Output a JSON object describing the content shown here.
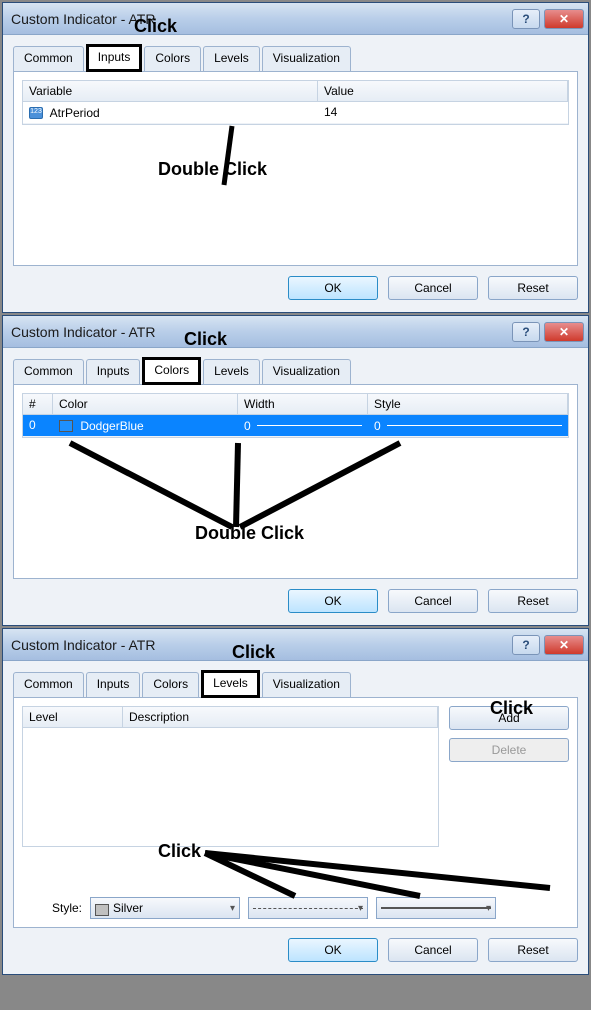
{
  "dialog1": {
    "title": "Custom Indicator - ATR",
    "tabs": [
      "Common",
      "Inputs",
      "Colors",
      "Levels",
      "Visualization"
    ],
    "activeTab": "Inputs",
    "annotations": {
      "clickLabel": "Click",
      "doubleClickLabel": "Double Click"
    },
    "table": {
      "headers": [
        "Variable",
        "Value"
      ],
      "rows": [
        {
          "variable": "AtrPeriod",
          "value": "14"
        }
      ]
    },
    "buttons": {
      "ok": "OK",
      "cancel": "Cancel",
      "reset": "Reset"
    }
  },
  "dialog2": {
    "title": "Custom Indicator - ATR",
    "tabs": [
      "Common",
      "Inputs",
      "Colors",
      "Levels",
      "Visualization"
    ],
    "activeTab": "Colors",
    "annotations": {
      "clickLabel": "Click",
      "doubleClickLabel": "Double Click"
    },
    "table": {
      "headers": [
        "#",
        "Color",
        "Width",
        "Style"
      ],
      "rows": [
        {
          "idx": "0",
          "color": "DodgerBlue",
          "colorHex": "#1E90FF",
          "width": "0",
          "style": "0"
        }
      ]
    },
    "buttons": {
      "ok": "OK",
      "cancel": "Cancel",
      "reset": "Reset"
    }
  },
  "dialog3": {
    "title": "Custom Indicator - ATR",
    "tabs": [
      "Common",
      "Inputs",
      "Colors",
      "Levels",
      "Visualization"
    ],
    "activeTab": "Levels",
    "annotations": {
      "clickLabel": "Click",
      "clickLabel2": "Click",
      "clickLabel3": "Click"
    },
    "table": {
      "headers": [
        "Level",
        "Description"
      ]
    },
    "sideButtons": {
      "add": "Add",
      "delete": "Delete"
    },
    "styleRow": {
      "label": "Style:",
      "colorName": "Silver",
      "colorHex": "#C0C0C0"
    },
    "buttons": {
      "ok": "OK",
      "cancel": "Cancel",
      "reset": "Reset"
    }
  }
}
